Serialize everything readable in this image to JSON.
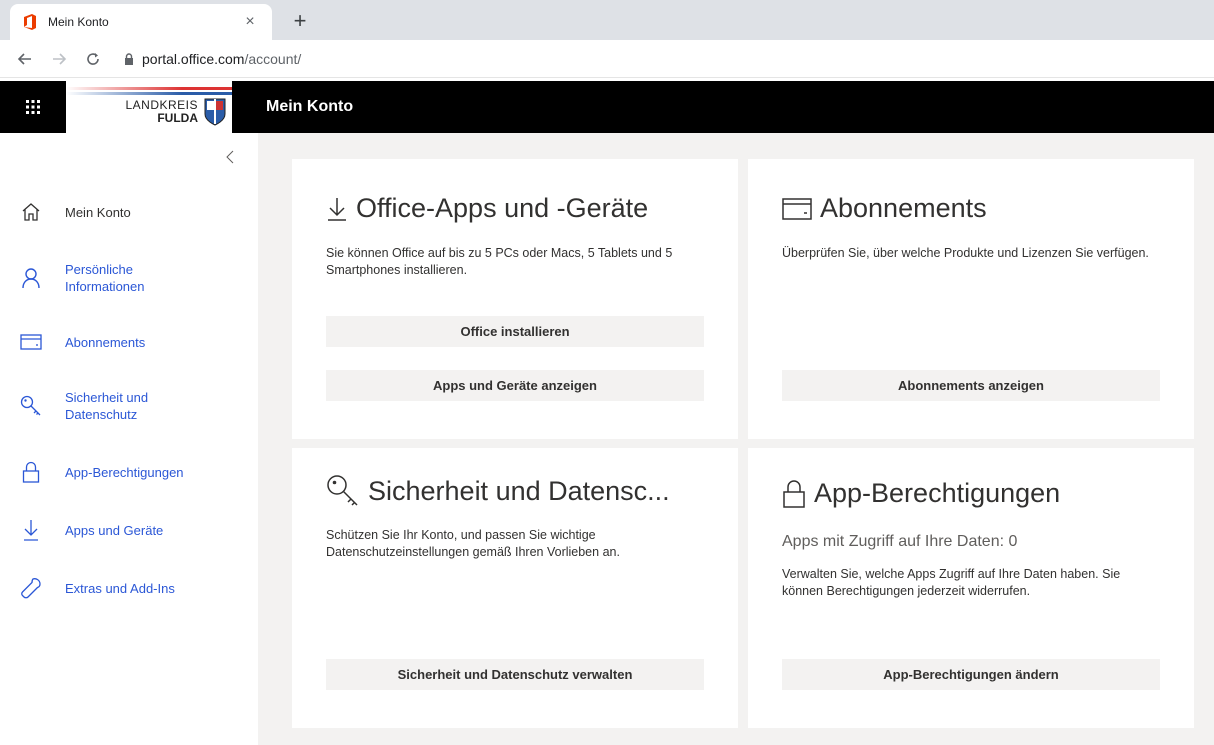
{
  "browser": {
    "tab_title": "Mein Konto",
    "tab_close": "×",
    "new_tab": "+",
    "url_host": "portal.office.com",
    "url_path": "/account/"
  },
  "header": {
    "logo_line1": "LANDKREIS",
    "logo_line2": "FULDA",
    "title": "Mein Konto"
  },
  "sidebar": {
    "items": [
      {
        "label": "Mein Konto",
        "icon": "home-icon"
      },
      {
        "label": "Persönliche Informationen",
        "icon": "person-icon"
      },
      {
        "label": "Abonnements",
        "icon": "card-icon"
      },
      {
        "label": "Sicherheit und Datenschutz",
        "icon": "key-icon"
      },
      {
        "label": "App-Berechtigungen",
        "icon": "lock-icon"
      },
      {
        "label": "Apps und Geräte",
        "icon": "download-icon"
      },
      {
        "label": "Extras und Add-Ins",
        "icon": "wrench-icon"
      }
    ]
  },
  "cards": {
    "office_apps": {
      "title": "Office-Apps und -Geräte",
      "desc": "Sie können Office auf bis zu 5 PCs oder Macs, 5 Tablets und 5 Smartphones installieren.",
      "btn1": "Office installieren",
      "btn2": "Apps und Geräte anzeigen"
    },
    "subscriptions": {
      "title": "Abonnements",
      "desc": "Überprüfen Sie, über welche Produkte und Lizenzen Sie verfügen.",
      "btn": "Abonnements anzeigen"
    },
    "security": {
      "title": "Sicherheit und Datensc...",
      "desc": "Schützen Sie Ihr Konto, und passen Sie wichtige Datenschutzeinstellungen gemäß Ihren Vorlieben an.",
      "btn": "Sicherheit und Datenschutz verwalten"
    },
    "permissions": {
      "title": "App-Berechtigungen",
      "subtitle": "Apps mit Zugriff auf Ihre Daten: 0",
      "desc": "Verwalten Sie, welche Apps Zugriff auf Ihre Daten haben. Sie können Berechtigungen jederzeit widerrufen.",
      "btn": "App-Berechtigungen ändern"
    }
  },
  "colors": {
    "accent_link": "#2b57d6",
    "header_bg": "#000000",
    "content_bg": "#f3f2f1",
    "office_red": "#eb3c00"
  }
}
